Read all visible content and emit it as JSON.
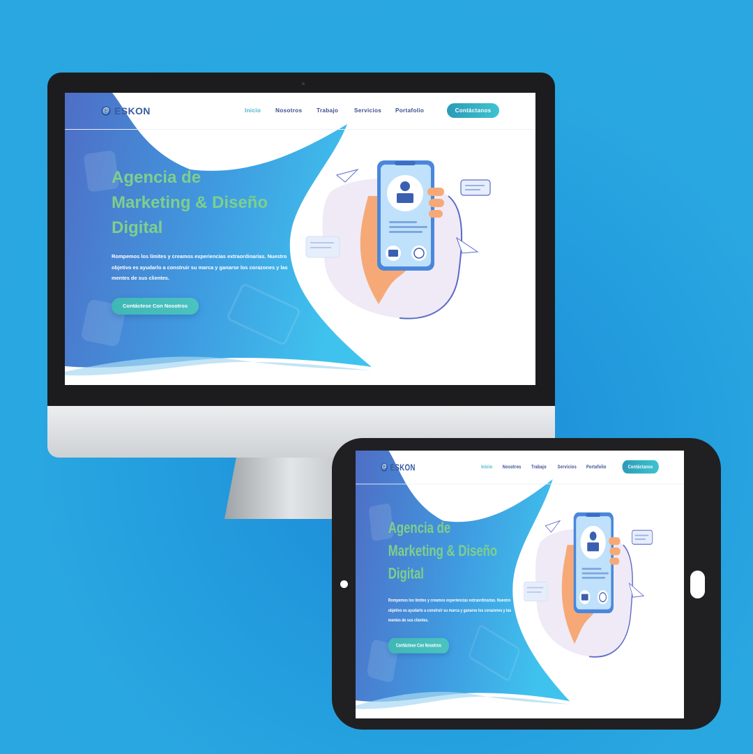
{
  "mockup": {
    "background_color": "#2aa6e1",
    "devices": [
      "desktop-monitor",
      "tablet"
    ]
  },
  "site": {
    "logo": {
      "text": "ESKON",
      "icon": "at-sign-icon"
    },
    "nav": {
      "links": [
        "Inicio",
        "Nosotros",
        "Trabajo",
        "Servicios",
        "Portafolio"
      ],
      "active": "Inicio",
      "cta_label": "Contáctanos"
    },
    "hero": {
      "title": "Agencia de\nMarketing & Diseño\nDigital",
      "description": "Rompemos los límites y creamos experiencias extraordinarias. Nuestro objetivo es ayudarlo a construir su marca y ganarse los corazones y las mentes de sus clientes.",
      "button_label": "Contáctese Con Nosotros"
    },
    "colors": {
      "gradient_start": "#4f6fc6",
      "gradient_end": "#3fbce8",
      "title_green": "#7ecf8c",
      "button_teal": "#3fb7b5",
      "nav_text": "#3e4f8f"
    },
    "illustration": "hand-holding-phone-with-profile"
  }
}
